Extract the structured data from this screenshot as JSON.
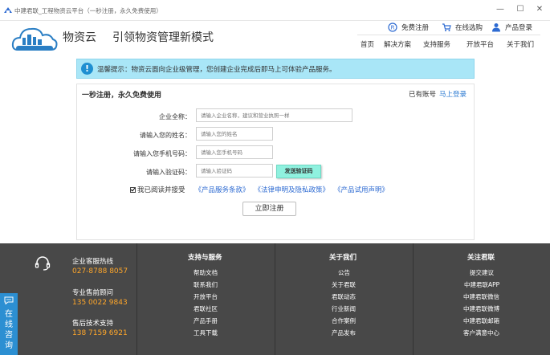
{
  "window": {
    "title": "中建君联_工程物资云平台（一秒注册，永久免费使用）",
    "minimize": "—",
    "maximize": "☐",
    "close": "✕"
  },
  "header": {
    "brand": "物资云",
    "slogan": "引领物资管理新模式",
    "top_links": [
      "免费注册",
      "在线选购",
      "产品登录"
    ],
    "nav": [
      "首页",
      "解决方案",
      "支持服务",
      "开放平台",
      "关于我们"
    ]
  },
  "notice": {
    "icon": "!",
    "text": "温馨提示：物资云面向企业级管理，您创建企业完成后即马上可体验产品服务。"
  },
  "form": {
    "title": "一秒注册，永久免费使用",
    "have_account": "已有账号",
    "login_link": "马上登录",
    "company_label": "企业全称：",
    "company_placeholder": "请输入企业名称，建议和营业执照一样",
    "name_label": "请输入您的姓名：",
    "name_placeholder": "请输入您的姓名",
    "phone_label": "请输入您手机号码：",
    "phone_placeholder": "请输入您手机号码",
    "code_label": "请输入验证码：",
    "code_placeholder": "请输入验证码",
    "send_code": "发送验证码",
    "agree_text": "我已阅读并接受",
    "agree_links": [
      "《产品服务条款》",
      "《法律申明及隐私政策》",
      "《产品试用声明》"
    ],
    "submit": "立即注册"
  },
  "footer": {
    "contact": [
      {
        "label": "企业客服热线",
        "number": "027-8788 8057"
      },
      {
        "label": "专业售前顾问",
        "number": "135 0022 9843"
      },
      {
        "label": "售后技术支持",
        "number": "138 7159 6921"
      }
    ],
    "columns": [
      {
        "title": "支持与服务",
        "items": [
          "帮助文档",
          "联系我们",
          "开放平台",
          "君联社区",
          "产品手册",
          "工具下载"
        ]
      },
      {
        "title": "关于我们",
        "items": [
          "公告",
          "关于君联",
          "君联动态",
          "行业新闻",
          "合作案例",
          "产品发布"
        ]
      },
      {
        "title": "关注君联",
        "items": [
          "提交建议",
          "中建君联APP",
          "中建君联微信",
          "中建君联微博",
          "中建君联邮箱",
          "客户满意中心"
        ]
      }
    ],
    "consult": "在线咨询"
  },
  "colors": {
    "accent": "#2e7bd2",
    "notice_bg": "#a9e6f7",
    "footer_bg": "#484848",
    "phone_orange": "#ffa72a",
    "send_btn": "#8ff1df"
  }
}
